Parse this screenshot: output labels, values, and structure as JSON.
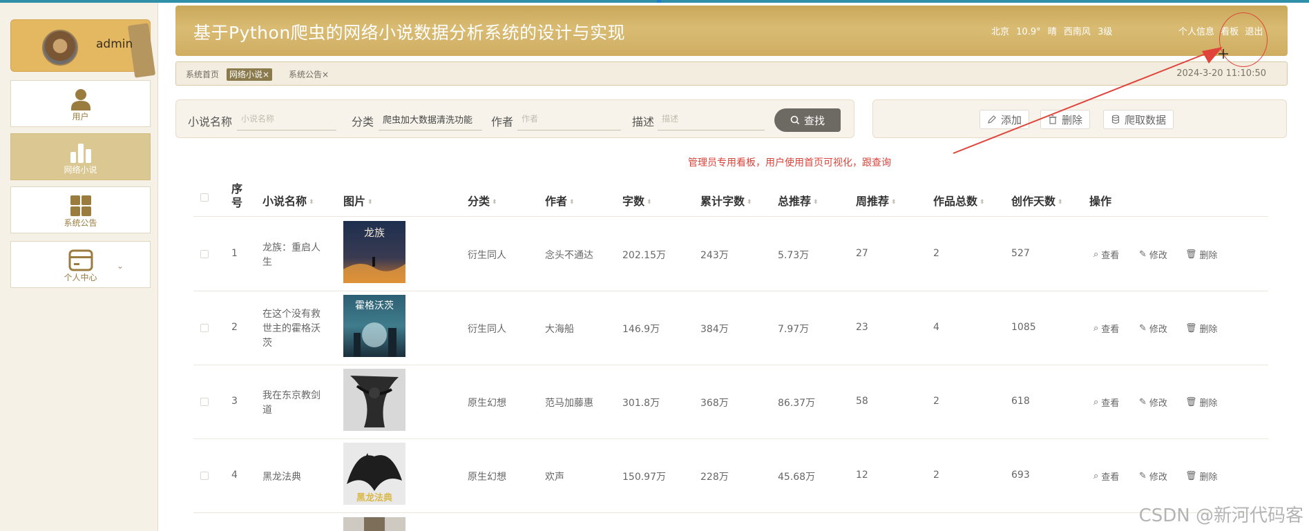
{
  "header": {
    "title": "基于Python爬虫的网络小说数据分析系统的设计与实现",
    "weather": [
      "北京",
      "10.9°",
      "晴",
      "西南风",
      "3级"
    ],
    "links": [
      "个人信息",
      "看板",
      "退出"
    ]
  },
  "user": {
    "name": "admin"
  },
  "sidebar": {
    "items": [
      {
        "label": "用户"
      },
      {
        "label": "网络小说"
      },
      {
        "label": "系统公告"
      },
      {
        "label": "个人中心"
      }
    ]
  },
  "tabs": {
    "items": [
      {
        "label": "系统首页"
      },
      {
        "label": "网络小说×"
      },
      {
        "label": "系统公告×"
      }
    ],
    "datetime": "2024-3-20 11:10:50"
  },
  "search": {
    "name_label": "小说名称",
    "name_placeholder": "小说名称",
    "category_label": "分类",
    "category_value": "爬虫加大数据清洗功能",
    "author_label": "作者",
    "author_placeholder": "作者",
    "desc_label": "描述",
    "desc_placeholder": "描述",
    "button": "查找"
  },
  "actions": {
    "add": "添加",
    "delete": "删除",
    "crawl": "爬取数据"
  },
  "annotation": "管理员专用看板，用户使用首页可视化，跟查询",
  "table": {
    "headers": {
      "index": "序号",
      "name": "小说名称",
      "image": "图片",
      "category": "分类",
      "author": "作者",
      "words": "字数",
      "total_words": "累计字数",
      "total_rec": "总推荐",
      "week_rec": "周推荐",
      "works": "作品总数",
      "days": "创作天数",
      "ops": "操作"
    },
    "rows": [
      {
        "index": "1",
        "name": "龙族：重启人生",
        "category": "衍生同人",
        "author": "念头不通达",
        "words": "202.15万",
        "total_words": "243万",
        "total_rec": "5.73万",
        "week_rec": "27",
        "works": "2",
        "days": "527"
      },
      {
        "index": "2",
        "name": "在这个没有救世主的霍格沃茨",
        "category": "衍生同人",
        "author": "大海船",
        "words": "146.9万",
        "total_words": "384万",
        "total_rec": "7.97万",
        "week_rec": "23",
        "works": "4",
        "days": "1085"
      },
      {
        "index": "3",
        "name": "我在东京教剑道",
        "category": "原生幻想",
        "author": "范马加藤惠",
        "words": "301.8万",
        "total_words": "368万",
        "total_rec": "86.37万",
        "week_rec": "58",
        "works": "2",
        "days": "618"
      },
      {
        "index": "4",
        "name": "黑龙法典",
        "category": "原生幻想",
        "author": "欢声",
        "words": "150.97万",
        "total_words": "228万",
        "total_rec": "45.68万",
        "week_rec": "12",
        "works": "2",
        "days": "693"
      }
    ],
    "ops": {
      "view": "查看",
      "edit": "修改",
      "delete": "删除"
    }
  },
  "watermark": "CSDN @新河代码客"
}
